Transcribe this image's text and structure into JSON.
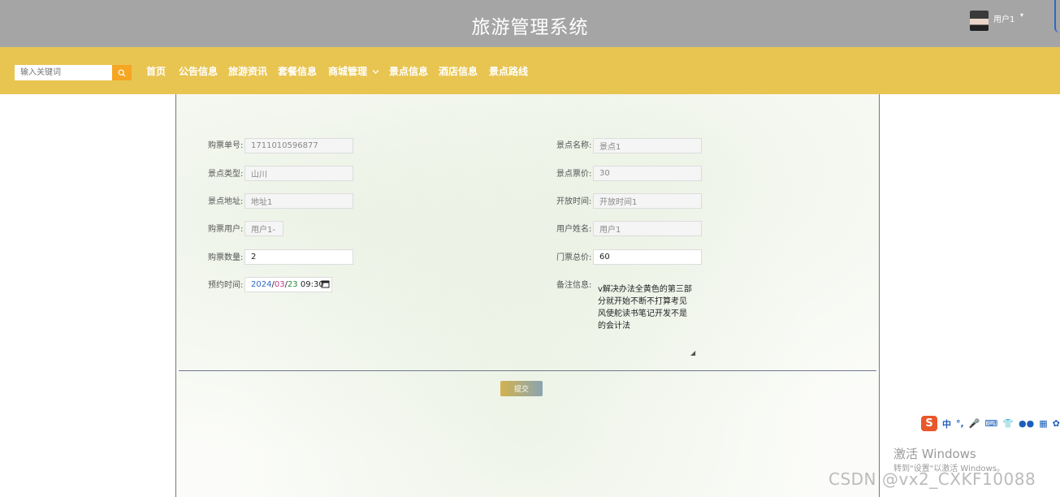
{
  "header": {
    "site_title": "旅游管理系统",
    "user_name": "用户1",
    "user_caret": "▾"
  },
  "nav": {
    "search_placeholder": "输入关键词",
    "items": [
      "首页",
      "公告信息",
      "旅游资讯",
      "套餐信息",
      "商城管理",
      "景点信息",
      "酒店信息",
      "景点路线"
    ]
  },
  "form": {
    "ticket_no": {
      "label": "购票单号:",
      "value": "1711010596877"
    },
    "spot_name": {
      "label": "景点名称:",
      "value": "景点1"
    },
    "spot_type": {
      "label": "景点类型:",
      "value": "山川"
    },
    "ticket_price": {
      "label": "景点票价:",
      "value": "30"
    },
    "spot_address": {
      "label": "景点地址:",
      "value": "地址1"
    },
    "open_time": {
      "label": "开放时间:",
      "value": "开放时间1"
    },
    "buyer": {
      "label": "购票用户:",
      "value": "用户1-"
    },
    "user_realname": {
      "label": "用户姓名:",
      "value": "用户1"
    },
    "quantity": {
      "label": "购票数量:",
      "value": "2"
    },
    "total_price": {
      "label": "门票总价:",
      "value": "60"
    },
    "reserve_time": {
      "label": "预约时间:",
      "year": "2024",
      "month": "03",
      "day": "23",
      "time": "09:30"
    },
    "remark": {
      "label": "备注信息:",
      "value": "v解决办法全黄色的第三部分就开始不断不打算考见风使舵读书笔记开发不是的会计法"
    },
    "submit_label": "提交"
  },
  "overlay": {
    "ime_glyphs": [
      "中",
      "°,",
      "🎤",
      "⌨",
      "👕",
      "●●",
      "▦",
      "✿"
    ],
    "activate_title": "激活 Windows",
    "activate_sub": "转到\"设置\"以激活 Windows。",
    "watermark": "CSDN @vx2_CXKF10088"
  },
  "colors": {
    "topbar": "#a5a5a5",
    "navbar": "#e8c551",
    "search_button": "#f5a623"
  }
}
